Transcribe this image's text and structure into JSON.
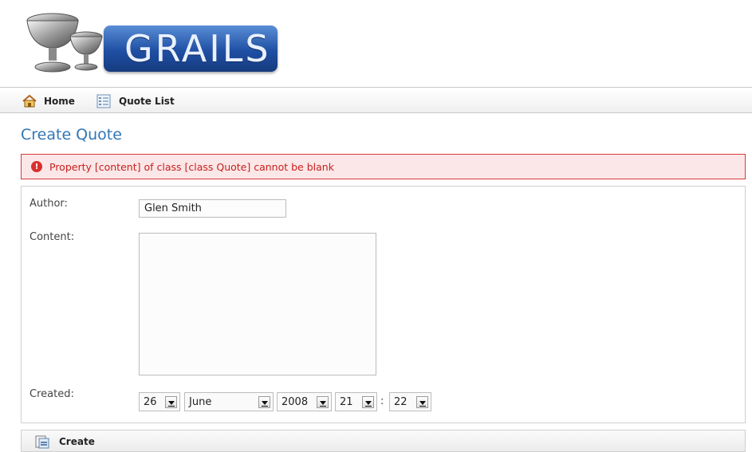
{
  "logo": {
    "text": "GRAILS"
  },
  "nav": {
    "items": [
      {
        "label": "Home",
        "icon": "home-icon"
      },
      {
        "label": "Quote List",
        "icon": "list-icon"
      }
    ]
  },
  "page": {
    "title": "Create Quote"
  },
  "error": {
    "message": "Property [content] of class [class Quote] cannot be blank"
  },
  "form": {
    "author_label": "Author:",
    "author_value": "Glen Smith",
    "content_label": "Content:",
    "content_value": "",
    "created_label": "Created:",
    "created": {
      "day": "26",
      "month": "June",
      "year": "2008",
      "hour": "21",
      "separator": ":",
      "minute": "22"
    }
  },
  "buttons": {
    "create_label": "Create"
  },
  "colors": {
    "title": "#3176b6",
    "error_text": "#c81e1e",
    "error_bg": "#fbe7e7",
    "logo_blue": "#1f4fa4"
  }
}
